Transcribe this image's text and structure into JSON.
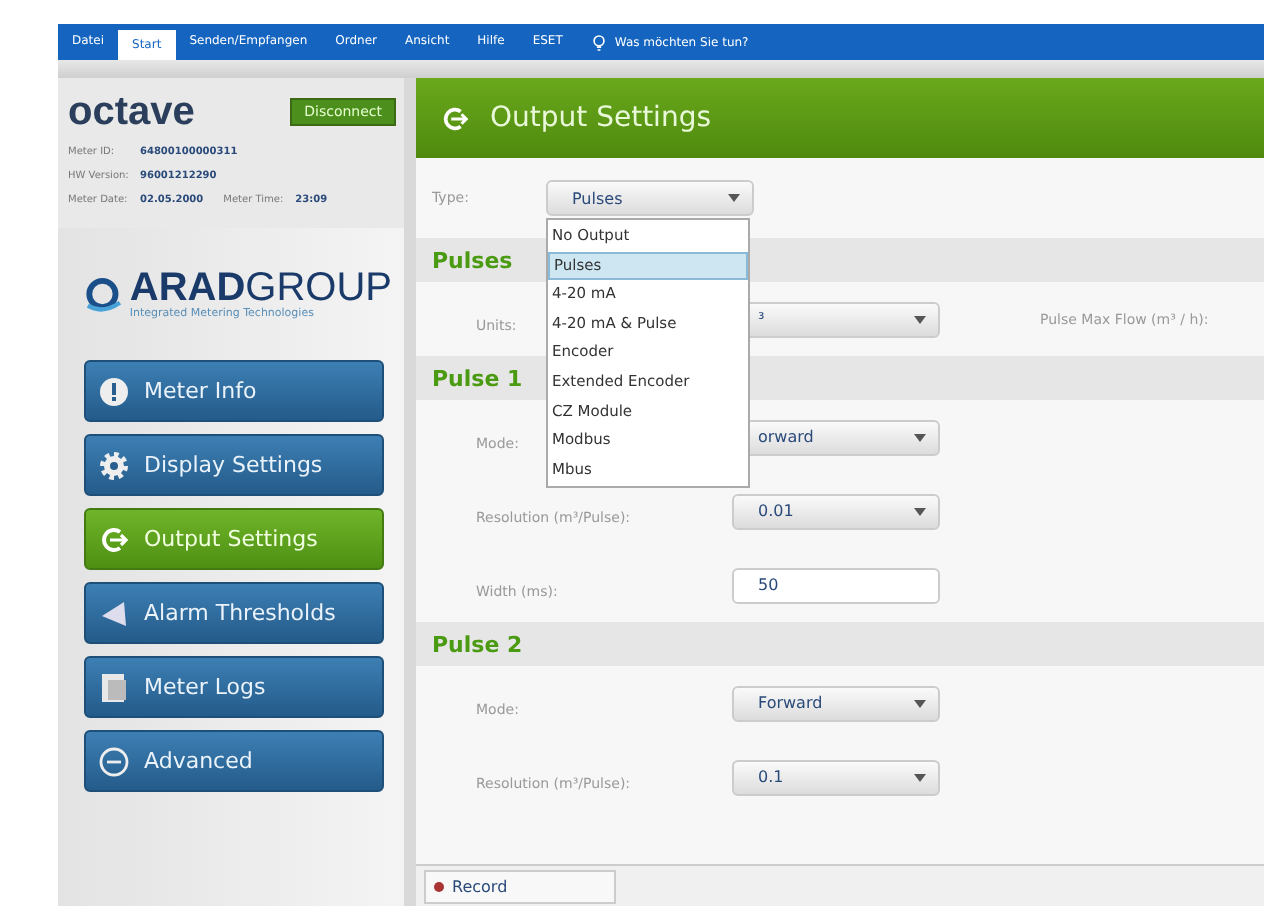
{
  "ribbon": {
    "tabs": [
      {
        "label": "Datei",
        "selected": false
      },
      {
        "label": "Start",
        "selected": true
      },
      {
        "label": "Senden/Empfangen",
        "selected": false
      },
      {
        "label": "Ordner",
        "selected": false
      },
      {
        "label": "Ansicht",
        "selected": false
      },
      {
        "label": "Hilfe",
        "selected": false
      },
      {
        "label": "ESET",
        "selected": false
      }
    ],
    "tell_me": "Was möchten Sie tun?"
  },
  "sidebar": {
    "logo": "octave",
    "disconnect": "Disconnect",
    "info": [
      [
        {
          "label": "Meter ID:",
          "value": "64800100000311"
        }
      ],
      [
        {
          "label": "HW Version:",
          "value": "96001212290"
        }
      ],
      [
        {
          "label": "Meter Date:",
          "value": "02.05.2000"
        },
        {
          "label": "Meter Time:",
          "value": "23:09"
        }
      ]
    ],
    "brand": {
      "bold": "ARAD",
      "light": "GROUP",
      "tagline": "Integrated Metering Technologies"
    },
    "nav": [
      {
        "label": "Meter Info",
        "selected": false
      },
      {
        "label": "Display Settings",
        "selected": false
      },
      {
        "label": "Output Settings",
        "selected": true
      },
      {
        "label": "Alarm Thresholds",
        "selected": false
      },
      {
        "label": "Meter Logs",
        "selected": false
      },
      {
        "label": "Advanced",
        "selected": false
      }
    ]
  },
  "main": {
    "title": "Output Settings",
    "type": {
      "label": "Type:",
      "value": "Pulses",
      "options": [
        {
          "label": "No Output",
          "selected": false
        },
        {
          "label": "Pulses",
          "selected": true
        },
        {
          "label": "4-20 mA",
          "selected": false
        },
        {
          "label": "4-20 mA & Pulse",
          "selected": false
        },
        {
          "label": "Encoder",
          "selected": false
        },
        {
          "label": "Extended Encoder",
          "selected": false
        },
        {
          "label": "CZ Module",
          "selected": false
        },
        {
          "label": "Modbus",
          "selected": false
        },
        {
          "label": "Mbus",
          "selected": false
        }
      ]
    },
    "sections": [
      {
        "title": "Pulses",
        "rows": [
          {
            "kind": "select",
            "label": "Units:",
            "value": "³",
            "side_label": "Pulse Max Flow (m³ / h):"
          }
        ]
      },
      {
        "title": "Pulse 1",
        "rows": [
          {
            "kind": "select",
            "label": "Mode:",
            "value": "orward"
          },
          {
            "kind": "select",
            "label": "Resolution (m³/Pulse):",
            "value": "0.01"
          },
          {
            "kind": "input",
            "label": "Width (ms):",
            "value": "50"
          }
        ]
      },
      {
        "title": "Pulse 2",
        "rows": [
          {
            "kind": "select",
            "label": "Mode:",
            "value": "Forward"
          },
          {
            "kind": "select",
            "label": "Resolution (m³/Pulse):",
            "value": "0.1"
          }
        ]
      }
    ]
  },
  "record": "Record"
}
